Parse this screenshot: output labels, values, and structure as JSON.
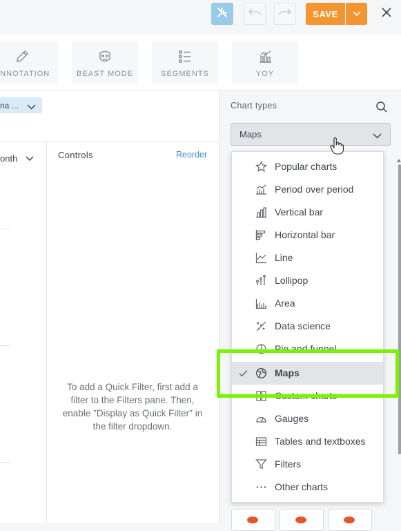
{
  "toolbar": {
    "save_label": "SAVE",
    "icons": [
      "tools-icon",
      "undo-icon",
      "redo-icon",
      "chevron-down-icon",
      "close-icon"
    ],
    "colors": {
      "accent": "#f39530",
      "tools_active": "#99cbe9"
    }
  },
  "tools": [
    {
      "label": "ANNOTATION",
      "icon": "pencil-icon"
    },
    {
      "label": "BEAST MODE",
      "icon": "beast-face-icon"
    },
    {
      "label": "SEGMENTS",
      "icon": "segments-icon"
    },
    {
      "label": "YOY",
      "icon": "yoy-chart-icon"
    }
  ],
  "left": {
    "filter_chip": "na ...",
    "month_label": "onth",
    "controls_title": "Controls",
    "reorder_label": "Reorder",
    "quick_filter_text": "To add a Quick Filter, first add a filter to the Filters pane. Then, enable \"Display as Quick Filter\" in the filter dropdown."
  },
  "chart_types": {
    "title": "Chart types",
    "selected": "Maps",
    "items": [
      {
        "label": "Popular charts",
        "icon": "star-icon"
      },
      {
        "label": "Period over period",
        "icon": "period-over-period-icon"
      },
      {
        "label": "Vertical bar",
        "icon": "vertical-bar-icon"
      },
      {
        "label": "Horizontal bar",
        "icon": "horizontal-bar-icon"
      },
      {
        "label": "Line",
        "icon": "line-chart-icon"
      },
      {
        "label": "Lollipop",
        "icon": "lollipop-icon"
      },
      {
        "label": "Area",
        "icon": "area-chart-icon"
      },
      {
        "label": "Data science",
        "icon": "data-science-icon"
      },
      {
        "label": "Pie and funnel",
        "icon": "pie-icon"
      },
      {
        "label": "Maps",
        "icon": "globe-icon",
        "selected": true
      },
      {
        "label": "Custom charts",
        "icon": "custom-charts-icon"
      },
      {
        "label": "Gauges",
        "icon": "gauge-icon"
      },
      {
        "label": "Tables and textboxes",
        "icon": "table-icon"
      },
      {
        "label": "Filters",
        "icon": "filter-icon"
      },
      {
        "label": "Other charts",
        "icon": "more-icon"
      }
    ]
  }
}
